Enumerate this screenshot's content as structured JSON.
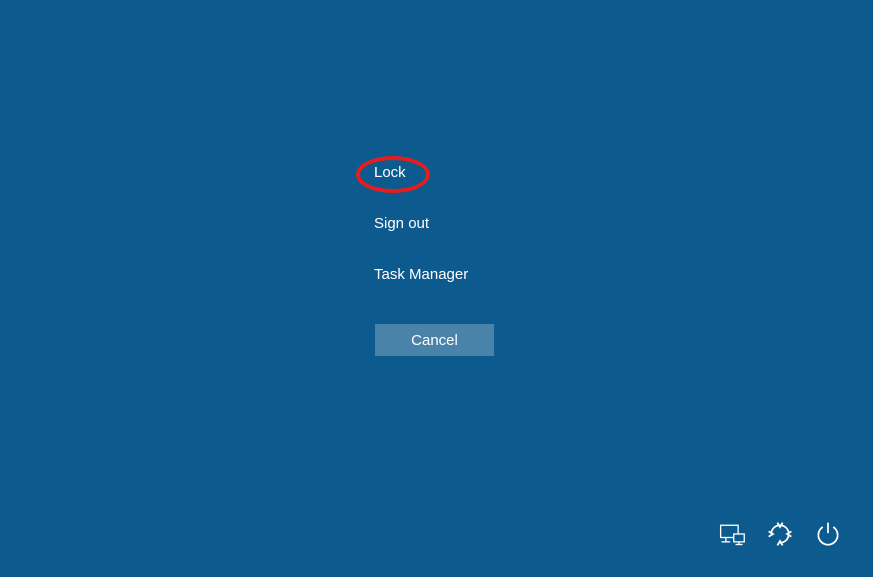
{
  "menu": {
    "items": [
      {
        "label": "Lock"
      },
      {
        "label": "Sign out"
      },
      {
        "label": "Task Manager"
      }
    ],
    "cancel_label": "Cancel"
  },
  "icons": {
    "network": "network-icon",
    "ease_of_access": "ease-of-access-icon",
    "power": "power-icon"
  },
  "annotation": {
    "highlighted_item": "Lock"
  }
}
